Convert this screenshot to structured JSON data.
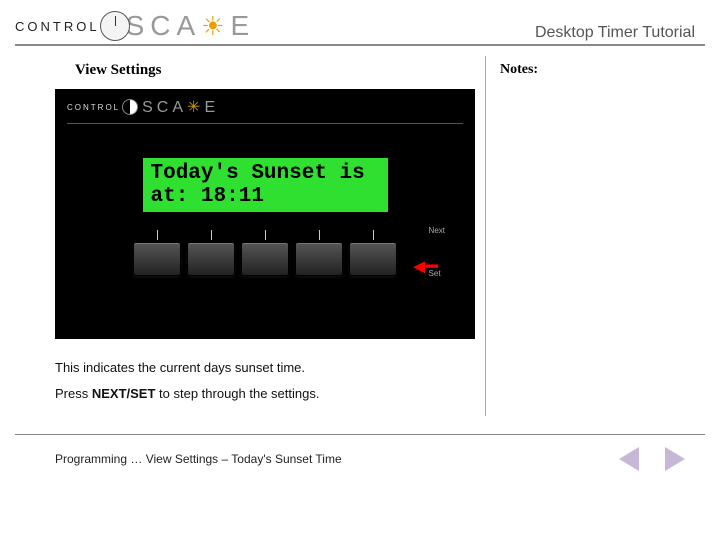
{
  "header": {
    "logo_control": "CONTROL",
    "logo_scape_pre": "SCA",
    "logo_scape_post": "E",
    "title": "Desktop Timer Tutorial"
  },
  "section": {
    "title": "View Settings"
  },
  "device": {
    "logo_control": "CONTROL",
    "logo_scape_pre": "SCA",
    "logo_scape_post": "E",
    "lcd_line1": "Today's Sunset is",
    "lcd_line2": "at:   18:11",
    "btn_label_top": "Next",
    "btn_label_bottom": "Set"
  },
  "description": {
    "line1": "This indicates the current days sunset time.",
    "line2_pre": "Press ",
    "line2_strong": "NEXT/SET",
    "line2_post": " to step through the settings."
  },
  "notes": {
    "title": "Notes:"
  },
  "footer": {
    "breadcrumb": "Programming … View Settings – Today's Sunset Time"
  }
}
